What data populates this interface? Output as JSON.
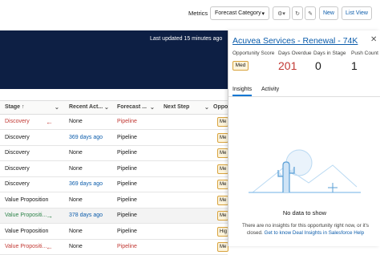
{
  "toolbar": {
    "metrics_label": "Metrics",
    "forecast_select": "Forecast Category",
    "new_label": "New",
    "list_view_label": "List View"
  },
  "banner": {
    "updated_text": "Last updated 15 minutes ago"
  },
  "table": {
    "headers": [
      "Stage ↑",
      "Recent Act...",
      "Forecast ...",
      "Next Step",
      "Oppo"
    ],
    "rows": [
      {
        "stage": "Discovery",
        "stage_color": "red",
        "arrow": "←",
        "recent": "None",
        "recent_link": false,
        "forecast": "Pipeline",
        "forecast_link": true,
        "badge": "Me"
      },
      {
        "stage": "Discovery",
        "stage_color": "normal",
        "arrow": "",
        "recent": "369 days ago",
        "recent_link": true,
        "forecast": "Pipeline",
        "forecast_link": false,
        "badge": "Me"
      },
      {
        "stage": "Discovery",
        "stage_color": "normal",
        "arrow": "",
        "recent": "None",
        "recent_link": false,
        "forecast": "Pipeline",
        "forecast_link": false,
        "badge": "Me"
      },
      {
        "stage": "Discovery",
        "stage_color": "normal",
        "arrow": "",
        "recent": "None",
        "recent_link": false,
        "forecast": "Pipeline",
        "forecast_link": false,
        "badge": "Me"
      },
      {
        "stage": "Discovery",
        "stage_color": "normal",
        "arrow": "",
        "recent": "369 days ago",
        "recent_link": true,
        "forecast": "Pipeline",
        "forecast_link": false,
        "badge": "Me"
      },
      {
        "stage": "Value Proposition",
        "stage_color": "normal",
        "arrow": "",
        "recent": "None",
        "recent_link": false,
        "forecast": "Pipeline",
        "forecast_link": false,
        "badge": "Me"
      },
      {
        "stage": "Value Propositi...",
        "stage_color": "green",
        "arrow": "→",
        "recent": "378 days ago",
        "recent_link": true,
        "forecast": "Pipeline",
        "forecast_link": false,
        "badge": "Me"
      },
      {
        "stage": "Value Proposition",
        "stage_color": "normal",
        "arrow": "",
        "recent": "None",
        "recent_link": false,
        "forecast": "Pipeline",
        "forecast_link": false,
        "badge": "Hig"
      },
      {
        "stage": "Value Propositi...",
        "stage_color": "red",
        "arrow": "←",
        "recent": "None",
        "recent_link": false,
        "forecast": "Pipeline",
        "forecast_link": true,
        "badge": "Me"
      }
    ]
  },
  "panel": {
    "title": "Acuvea Services - Renewal - 74K",
    "stats": [
      {
        "label": "Opportunity Score",
        "value": "Med"
      },
      {
        "label": "Days Overdue",
        "value": "201"
      },
      {
        "label": "Days in Stage",
        "value": "0"
      },
      {
        "label": "Push Count",
        "value": "1"
      }
    ],
    "tabs": [
      "Insights",
      "Activity"
    ],
    "no_data_title": "No data to show",
    "no_data_msg_1": "There are no insights for this opportunity right now, or it's",
    "no_data_msg_2": "closed.",
    "no_data_link": "Get to know Deal Insights in Salesforce Help"
  },
  "colors": {
    "accent": "#0176d3",
    "banner": "#0d1f44",
    "overdue": "#c23934",
    "link": "#0b5cab"
  }
}
